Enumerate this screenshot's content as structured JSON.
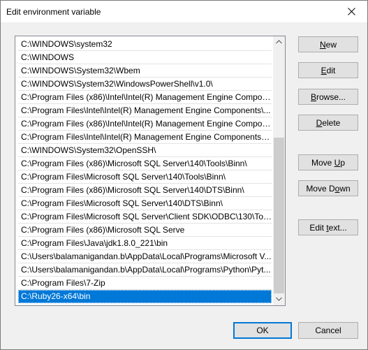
{
  "window": {
    "title": "Edit environment variable",
    "close_glyph": "×"
  },
  "path_list": {
    "items": [
      "C:\\WINDOWS\\system32",
      "C:\\WINDOWS",
      "C:\\WINDOWS\\System32\\Wbem",
      "C:\\WINDOWS\\System32\\WindowsPowerShell\\v1.0\\",
      "C:\\Program Files (x86)\\Intel\\Intel(R) Management Engine Compon...",
      "C:\\Program Files\\Intel\\Intel(R) Management Engine Components\\...",
      "C:\\Program Files (x86)\\Intel\\Intel(R) Management Engine Compon...",
      "C:\\Program Files\\Intel\\Intel(R) Management Engine Components\\I...",
      "C:\\WINDOWS\\System32\\OpenSSH\\",
      "C:\\Program Files (x86)\\Microsoft SQL Server\\140\\Tools\\Binn\\",
      "C:\\Program Files\\Microsoft SQL Server\\140\\Tools\\Binn\\",
      "C:\\Program Files (x86)\\Microsoft SQL Server\\140\\DTS\\Binn\\",
      "C:\\Program Files\\Microsoft SQL Server\\140\\DTS\\Binn\\",
      "C:\\Program Files\\Microsoft SQL Server\\Client SDK\\ODBC\\130\\Tool...",
      "C:\\Program Files (x86)\\Microsoft SQL Serve",
      "C:\\Program Files\\Java\\jdk1.8.0_221\\bin",
      "C:\\Users\\balamanigandan.b\\AppData\\Local\\Programs\\Microsoft V...",
      "C:\\Users\\balamanigandan.b\\AppData\\Local\\Programs\\Python\\Pyt...",
      "C:\\Program Files\\7-Zip",
      "C:\\Ruby26-x64\\bin"
    ],
    "selected_index": 19
  },
  "buttons": {
    "new": {
      "pre": "",
      "key": "N",
      "post": "ew"
    },
    "edit": {
      "pre": "",
      "key": "E",
      "post": "dit"
    },
    "browse": {
      "pre": "",
      "key": "B",
      "post": "rowse..."
    },
    "delete": {
      "pre": "",
      "key": "D",
      "post": "elete"
    },
    "move_up": {
      "pre": "Move ",
      "key": "U",
      "post": "p"
    },
    "move_down": {
      "pre": "Move D",
      "key": "o",
      "post": "wn"
    },
    "edit_text": {
      "pre": "Edit ",
      "key": "t",
      "post": "ext..."
    },
    "ok": "OK",
    "cancel": "Cancel"
  },
  "colors": {
    "selection": "#0078d7",
    "default_button_border": "#0078d7",
    "button_face": "#e1e1e1",
    "dialog_background": "#f0f0f0"
  }
}
